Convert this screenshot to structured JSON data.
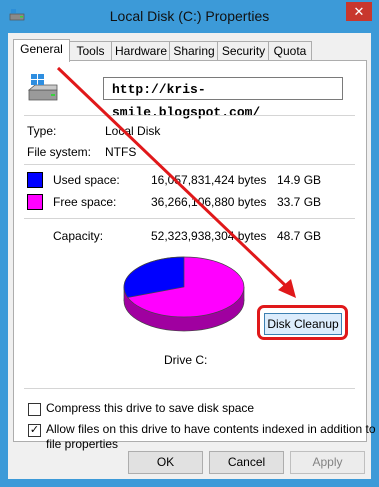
{
  "window": {
    "title": "Local Disk (C:) Properties",
    "close_glyph": "✕"
  },
  "tabs": [
    {
      "label": "General",
      "active": true
    },
    {
      "label": "Tools"
    },
    {
      "label": "Hardware"
    },
    {
      "label": "Sharing"
    },
    {
      "label": "Security"
    },
    {
      "label": "Quota"
    }
  ],
  "general": {
    "name_value": "http://kris-smile.blogspot.com/",
    "type_label": "Type:",
    "type_value": "Local Disk",
    "fs_label": "File system:",
    "fs_value": "NTFS",
    "used": {
      "label": "Used space:",
      "bytes": "16,057,831,424 bytes",
      "size": "14.9 GB",
      "color": "#0000ff"
    },
    "free": {
      "label": "Free space:",
      "bytes": "36,266,106,880 bytes",
      "size": "33.7 GB",
      "color": "#ff00ff"
    },
    "capacity": {
      "label": "Capacity:",
      "bytes": "52,323,938,304 bytes",
      "size": "48.7 GB"
    },
    "used_fraction": 0.307,
    "drive_label": "Drive C:",
    "cleanup_label": "Disk Cleanup",
    "compress_label": "Compress this drive to save disk space",
    "compress_checked": false,
    "index_label_line1": "Allow files on this drive to have contents indexed in addition to",
    "index_label_line2": "file properties",
    "index_checked": true,
    "check_glyph": "✓"
  },
  "buttons": {
    "ok": "OK",
    "cancel": "Cancel",
    "apply": "Apply"
  },
  "annotation_color": "#e0181a"
}
